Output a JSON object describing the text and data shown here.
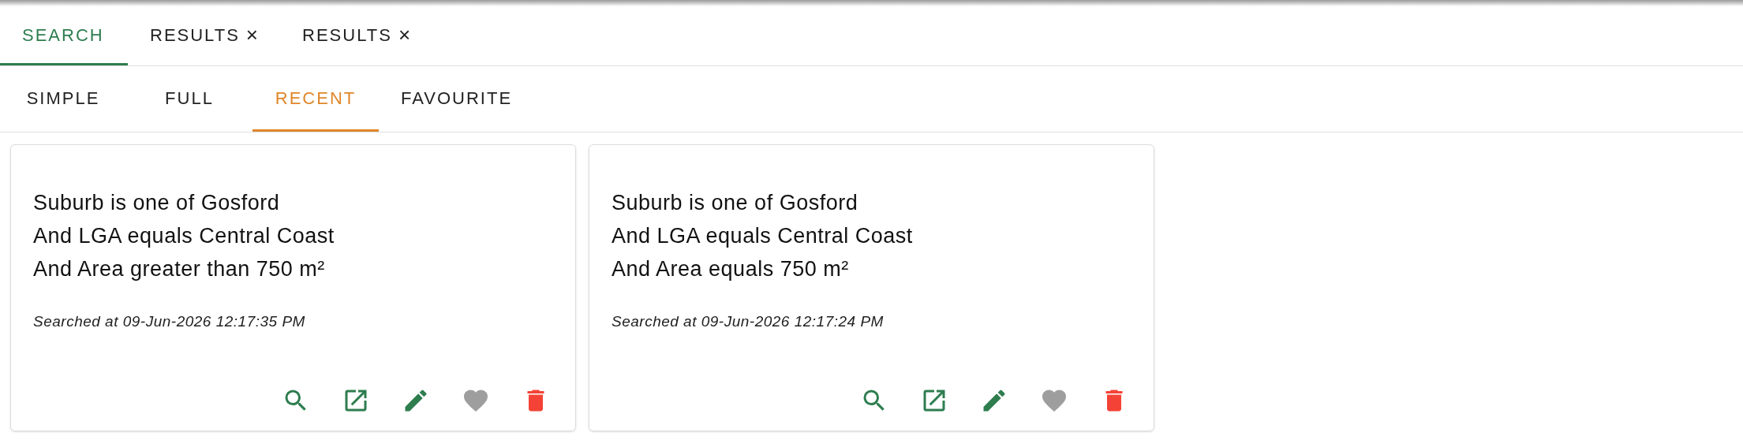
{
  "main_tabs": [
    {
      "label": "SEARCH",
      "selected": true
    },
    {
      "label": "RESULTS",
      "close": "×",
      "selected": false
    },
    {
      "label": "RESULTS",
      "close": "×",
      "selected": false
    }
  ],
  "search_tabs": [
    {
      "label": "SIMPLE",
      "selected": false
    },
    {
      "label": "FULL",
      "selected": false
    },
    {
      "label": "RECENT",
      "selected": true
    },
    {
      "label": "FAVOURITE",
      "selected": false
    }
  ],
  "recent_searches": [
    {
      "criteria": [
        "Suburb is one of Gosford",
        "And LGA equals Central Coast",
        "And Area greater than 750 m²"
      ],
      "searched_at": "Searched at 09-Jun-2026 12:17:35 PM",
      "favourite": false
    },
    {
      "criteria": [
        "Suburb is one of Gosford",
        "And LGA equals Central Coast",
        "And Area equals 750 m²"
      ],
      "searched_at": "Searched at 09-Jun-2026 12:17:24 PM",
      "favourite": false
    }
  ]
}
